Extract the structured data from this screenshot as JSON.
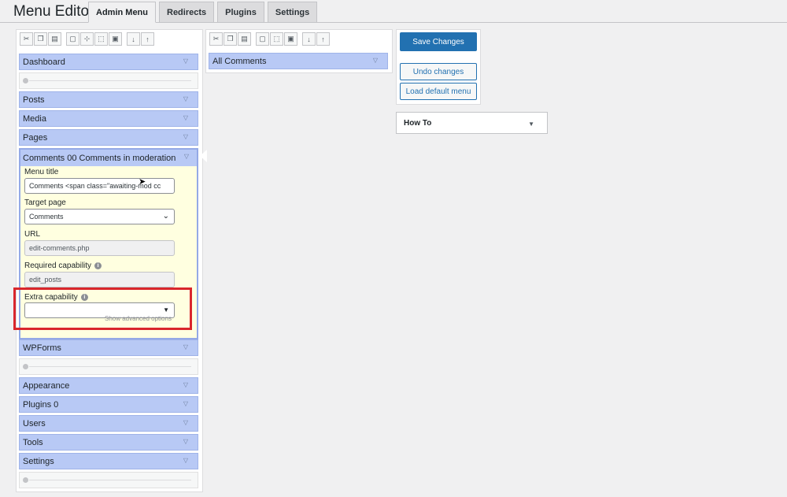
{
  "page": {
    "title": "Menu Editor"
  },
  "tabs": [
    {
      "label": "Admin Menu",
      "active": true
    },
    {
      "label": "Redirects"
    },
    {
      "label": "Plugins"
    },
    {
      "label": "Settings"
    }
  ],
  "left_menu": {
    "items": {
      "dashboard": "Dashboard",
      "posts": "Posts",
      "media": "Media",
      "pages": "Pages",
      "comments": "Comments 00 Comments in moderation",
      "wpforms": "WPForms",
      "appearance": "Appearance",
      "plugins": "Plugins 0",
      "users": "Users",
      "tools": "Tools",
      "settings": "Settings"
    }
  },
  "editor": {
    "menu_title_label": "Menu title",
    "menu_title_value": "Comments <span class=\"awaiting-mod cc",
    "target_page_label": "Target page",
    "target_page_value": "Comments",
    "url_label": "URL",
    "url_value": "edit-comments.php",
    "required_cap_label": "Required capability",
    "required_cap_value": "edit_posts",
    "extra_cap_label": "Extra capability",
    "extra_cap_value": "",
    "advanced_link": "Show advanced options"
  },
  "submenu": {
    "items": {
      "all_comments": "All Comments"
    }
  },
  "actions": {
    "save": "Save Changes",
    "undo": "Undo changes",
    "load_default": "Load default menu"
  },
  "howto": {
    "label": "How To"
  },
  "colors": {
    "item_bg": "#b8c9f5",
    "editor_bg": "#ffffe0",
    "primary": "#2271b1",
    "highlight": "#d9262c"
  }
}
